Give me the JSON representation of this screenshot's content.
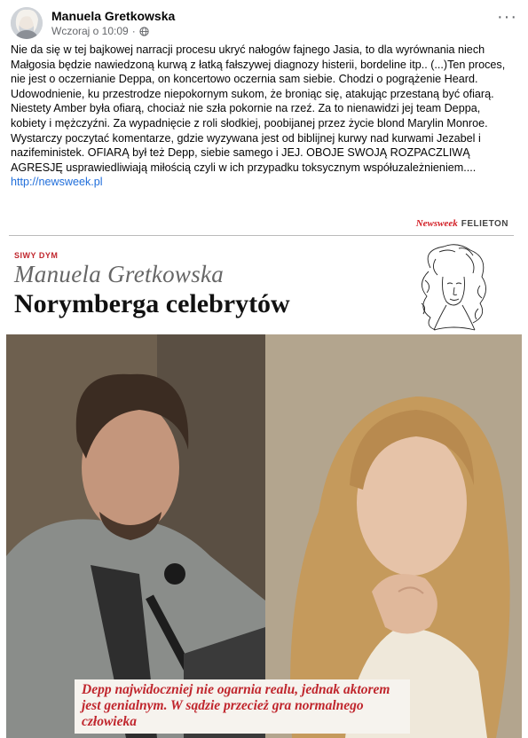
{
  "post": {
    "author": "Manuela Gretkowska",
    "timestamp": "Wczoraj o 10:09",
    "audience_icon": "globe-icon",
    "more_icon": "more-options-icon",
    "text": "Nie da się w tej bajkowej narracji procesu ukryć nałogów fajnego Jasia, to dla wyrównania niech Małgosia będzie nawiedzoną kurwą z łatką fałszywej diagnozy histerii, bordeline itp.. (...)Ten proces, nie jest o oczernianie Deppa, on koncertowo oczernia sam siebie. Chodzi o pogrążenie Heard. Udowodnienie, ku przestrodze niepokornym sukom, że broniąc się, atakując przestaną być ofiarą. Niestety Amber była ofiarą, chociaż nie szła pokornie na rzeź. Za to nienawidzi jej team Deppa, kobiety i mężczyźni. Za wypadnięcie z roli słodkiej, poobijanej przez życie blond Marylin Monroe. Wystarczy poczytać komentarze, gdzie wyzywana jest od biblijnej kurwy nad kurwami Jezabel i nazifeministek. OFIARĄ był też Depp, siebie samego i JEJ. OBOJE SWOJĄ ROZPACZLIWĄ AGRESJĘ usprawiedliwiają miłością czyli w ich przypadku toksycznym współuzależnieniem....",
    "link": "http://newsweek.pl"
  },
  "article": {
    "brand": "Newsweek",
    "section": "FELIETON",
    "column_label": "SIWY DYM",
    "columnist": "Manuela Gretkowska",
    "headline": "Norymberga celebrytów",
    "caption": "Depp najwidoczniej nie ogarnia realu, jednak aktorem jest genialnym. W sądzie przecież gra normalnego człowieka"
  },
  "colors": {
    "link": "#216fdb",
    "accent_red": "#c0262d",
    "meta_gray": "#65676b"
  }
}
